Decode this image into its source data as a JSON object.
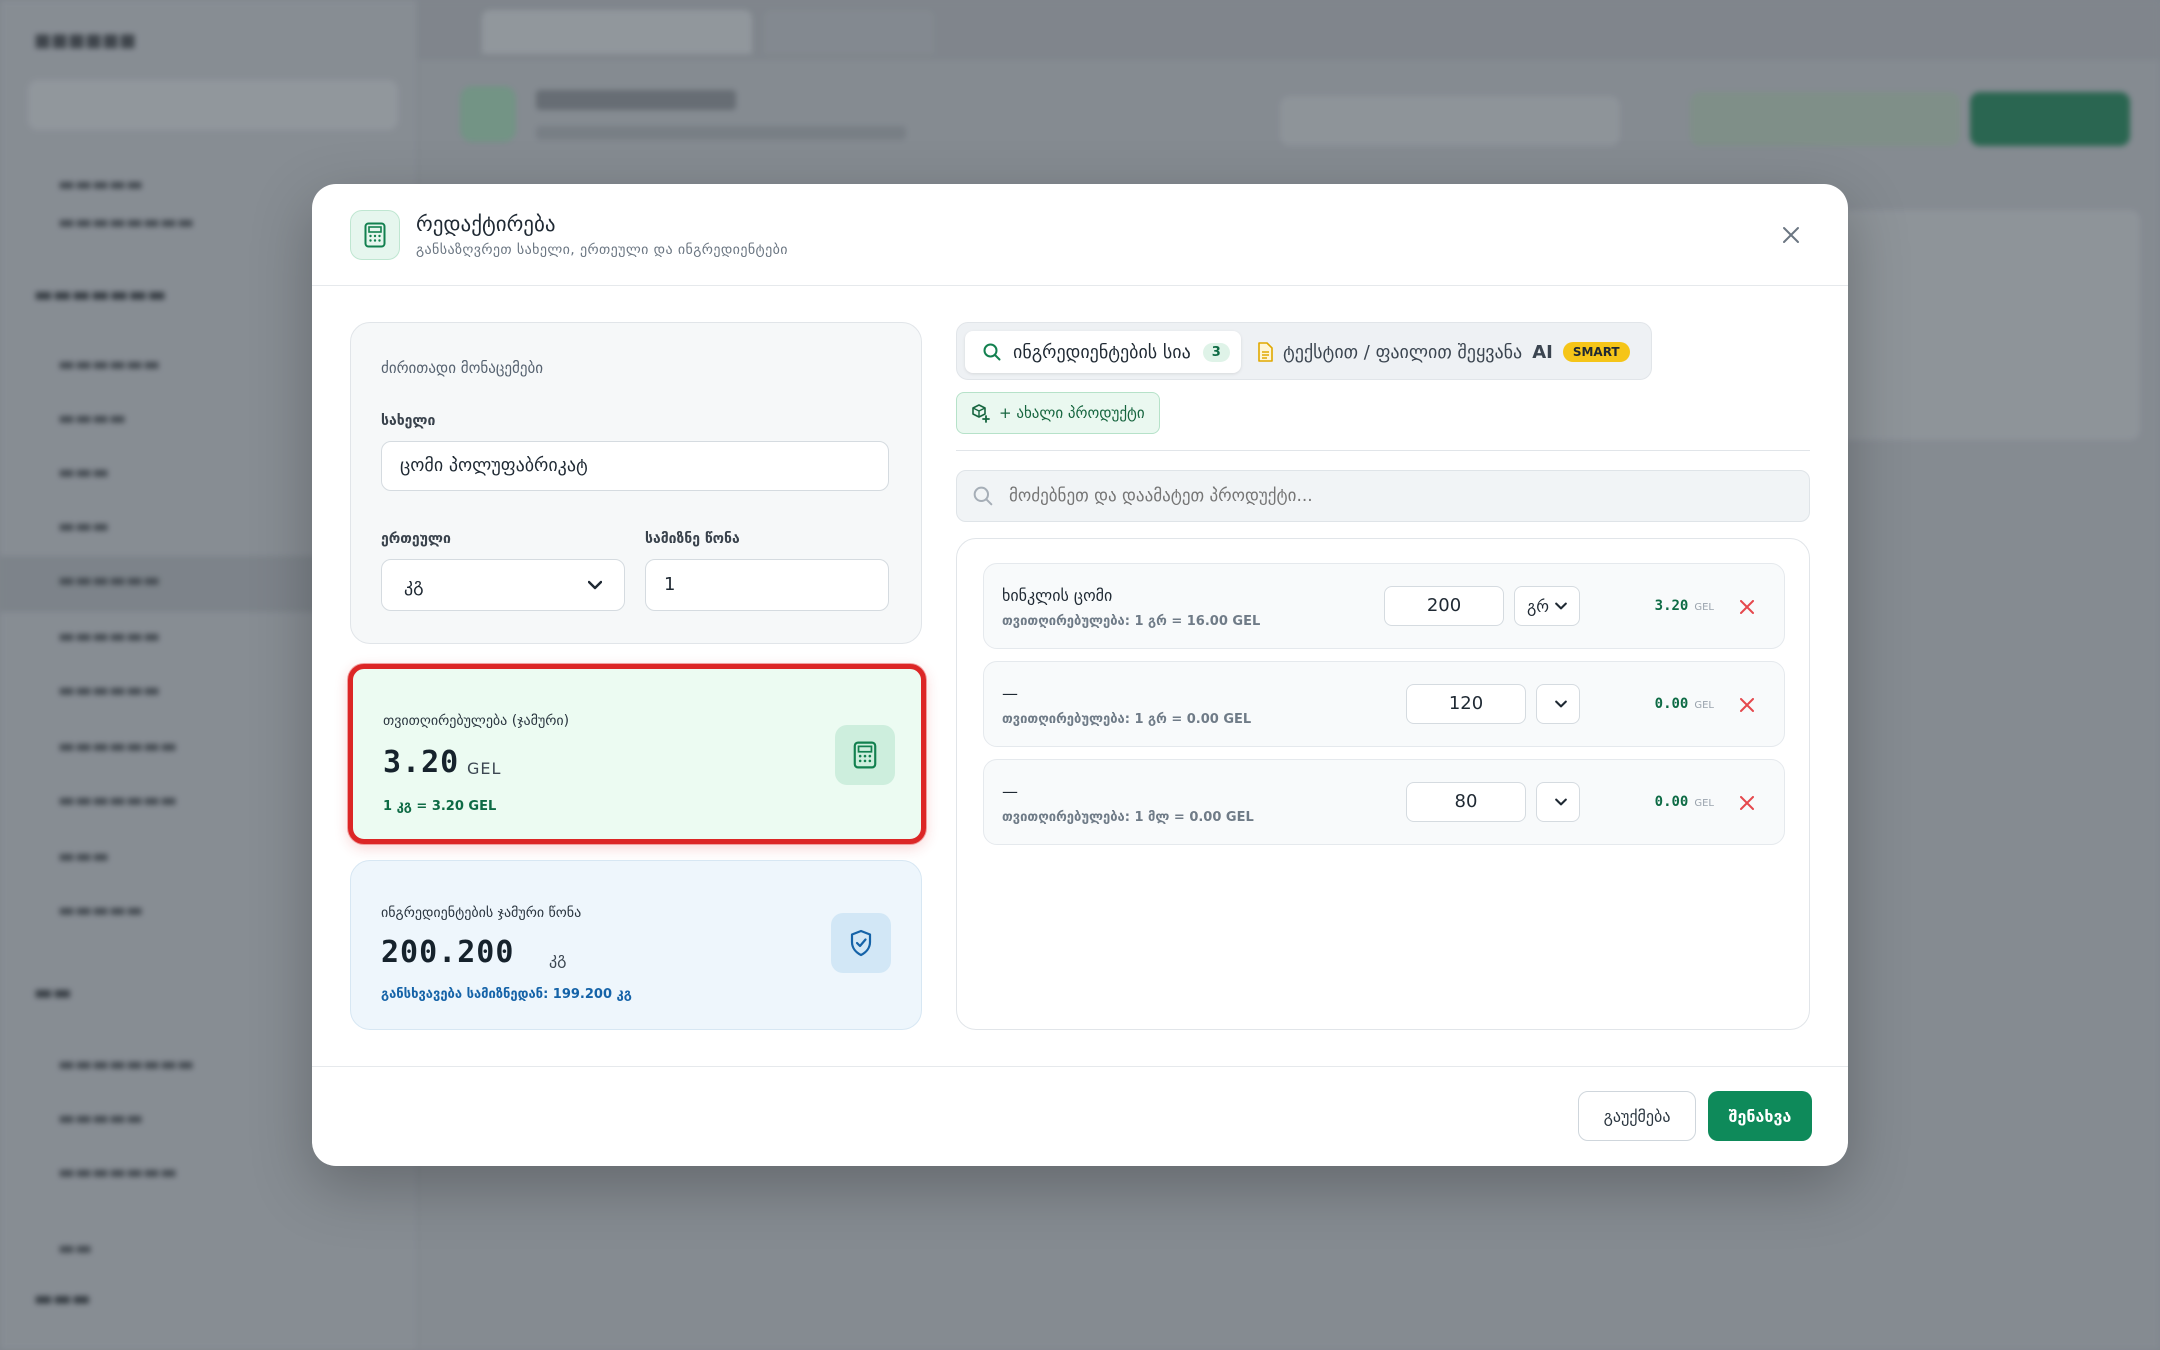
{
  "modal": {
    "title": "რედაქტირება",
    "subtitle": "განსაზღვრეთ სახელი, ერთეული და ინგრედიენტები",
    "icon": "calculator-icon",
    "accent_color": "#0e8a5a"
  },
  "basic": {
    "section_label": "ძირითადი მონაცემები",
    "name_label": "სახელი",
    "name_value": "ცომი პოლუფაბრიკატ",
    "unit_label": "ერთეული",
    "unit_value": "კგ",
    "weight_label": "სამიზნე წონა",
    "weight_value": "1"
  },
  "cost": {
    "label": "თვითღირებულება (ჯამური)",
    "value": "3.20",
    "currency": "GEL",
    "sub": "1 კგ = 3.20 GEL"
  },
  "total_weight": {
    "label": "ინგრედიენტების ჯამური წონა",
    "value": "200.200",
    "unit": "კგ",
    "sub": "განსხვავება სამიზნედან: 199.200 კგ"
  },
  "tabs": {
    "ingredients_label": "ინგრედიენტების სია",
    "ingredients_count": "3",
    "text_label": "ტექსტით / ფაილით შეყვანა",
    "ai_label": "AI",
    "smart_label": "SMART"
  },
  "new_product_label": "+ ახალი პროდუქტი",
  "search": {
    "placeholder": "მოძებნეთ და დაამატეთ პროდუქტი..."
  },
  "ingredients": [
    {
      "name": "ხინკლის ცომი",
      "meta": "თვითღირებულება: 1 გრ = 16.00 GEL",
      "qty": "200",
      "unit": "გრ",
      "cost": "3.20",
      "currency": "GEL"
    },
    {
      "name": "—",
      "meta": "თვითღირებულება: 1 გრ = 0.00 GEL",
      "qty": "120",
      "unit": "",
      "cost": "0.00",
      "currency": "GEL"
    },
    {
      "name": "—",
      "meta": "თვითღირებულება: 1 მლ = 0.00 GEL",
      "qty": "80",
      "unit": "",
      "cost": "0.00",
      "currency": "GEL"
    }
  ],
  "footer": {
    "cancel_label": "გაუქმება",
    "save_label": "შენახვა"
  }
}
